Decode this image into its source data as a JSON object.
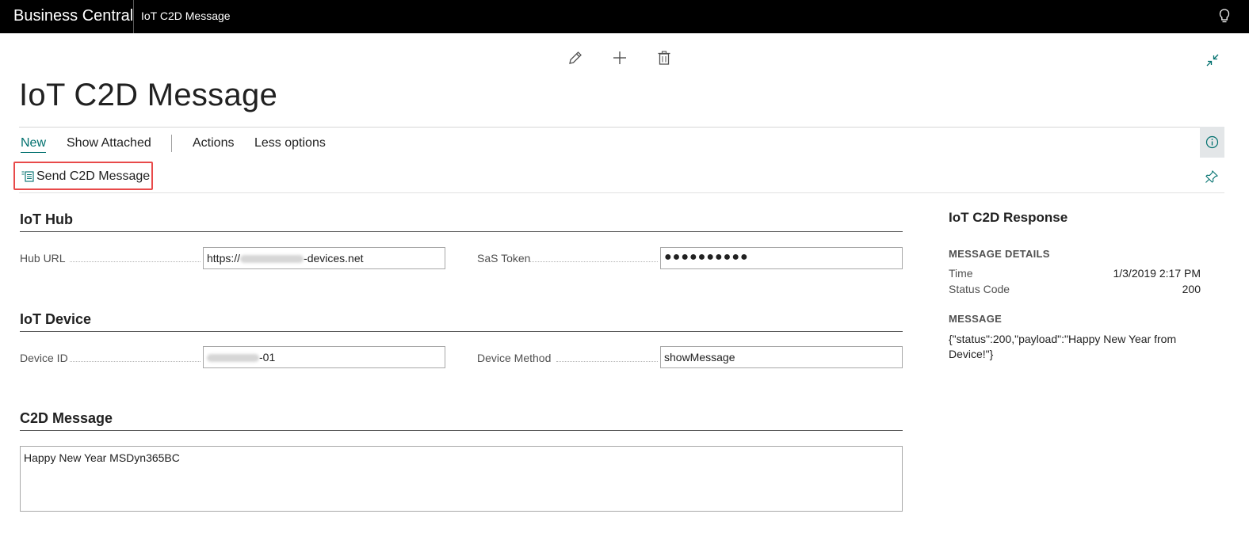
{
  "topbar": {
    "app_title": "Business Central",
    "page_crumb": "IoT C2D Message"
  },
  "page": {
    "title": "IoT C2D Message"
  },
  "actions": {
    "tabs": [
      "New",
      "Show Attached",
      "Actions",
      "Less options"
    ],
    "send_label": "Send C2D Message"
  },
  "iot_hub": {
    "title": "IoT Hub",
    "hub_url_label": "Hub URL",
    "hub_url_prefix": "https://",
    "hub_url_suffix": "-devices.net",
    "sas_token_label": "SaS Token",
    "sas_token_value": "●●●●●●●●●●"
  },
  "iot_device": {
    "title": "IoT Device",
    "device_id_label": "Device ID",
    "device_id_suffix": "-01",
    "device_method_label": "Device Method",
    "device_method_value": "showMessage"
  },
  "c2d_message": {
    "title": "C2D Message",
    "value": "Happy New Year MSDyn365BC"
  },
  "factbox": {
    "title": "IoT C2D Response",
    "details_heading": "MESSAGE DETAILS",
    "time_label": "Time",
    "time_value": "1/3/2019 2:17 PM",
    "status_label": "Status Code",
    "status_value": "200",
    "message_heading": "MESSAGE",
    "message_value": "{\"status\":200,\"payload\":\"Happy New Year from Device!\"}"
  },
  "icons": [
    "lightbulb-icon",
    "edit-icon",
    "add-icon",
    "delete-icon",
    "collapse-icon",
    "info-icon",
    "send-message-icon",
    "pin-icon"
  ],
  "colors": {
    "topbar": "#000000",
    "accent": "#00706e",
    "highlight_border": "#e84a4a"
  }
}
